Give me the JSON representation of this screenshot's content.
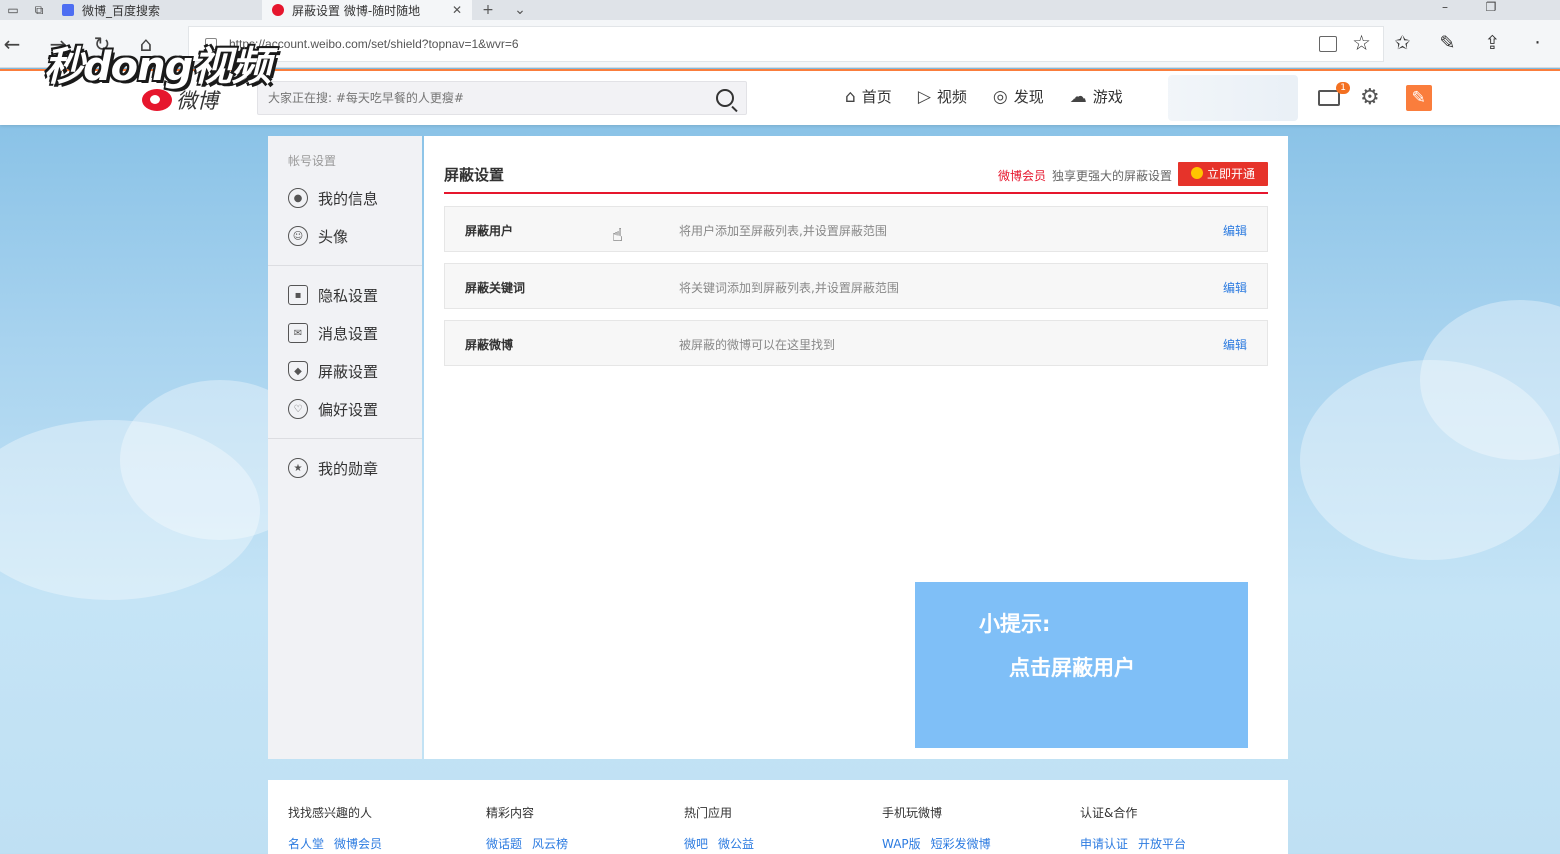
{
  "browser": {
    "tabs": [
      {
        "title": "微博_百度搜索",
        "active": false
      },
      {
        "title": "屏蔽设置 微博-随时随地",
        "active": true
      }
    ],
    "address": "https://account.weibo.com/set/shield?topnav=1&wvr=6",
    "icons": [
      "back-icon",
      "forward-icon",
      "refresh-icon",
      "home-icon",
      "lock-icon",
      "reading-view-icon",
      "favorite-star-icon",
      "favorites-hub-icon",
      "pen-icon",
      "share-icon",
      "more-icon"
    ]
  },
  "watermark": "秒dong视频",
  "header": {
    "logo_text": "微博",
    "search_placeholder": "大家正在搜: #每天吃早餐的人更瘦#",
    "nav": [
      {
        "label": "首页",
        "icon": "home-icon"
      },
      {
        "label": "视频",
        "icon": "video-icon"
      },
      {
        "label": "发现",
        "icon": "compass-icon"
      },
      {
        "label": "游戏",
        "icon": "gamepad-icon"
      }
    ],
    "mail_badge": "1",
    "accent": "#fa7d3c"
  },
  "sidebar": {
    "group_title": "帐号设置",
    "items": [
      {
        "label": "我的信息",
        "icon": "user-icon"
      },
      {
        "label": "头像",
        "icon": "avatar-icon"
      },
      {
        "label": "隐私设置",
        "icon": "lock-icon"
      },
      {
        "label": "消息设置",
        "icon": "message-icon"
      },
      {
        "label": "屏蔽设置",
        "icon": "shield-icon"
      },
      {
        "label": "偏好设置",
        "icon": "heart-icon"
      },
      {
        "label": "我的勋章",
        "icon": "medal-icon"
      }
    ]
  },
  "content": {
    "title": "屏蔽设置",
    "vip_link": "微博会员",
    "vip_note": "独享更强大的屏蔽设置",
    "vip_button": "立即开通",
    "rows": [
      {
        "name": "屏蔽用户",
        "desc": "将用户添加至屏蔽列表,并设置屏蔽范围",
        "action": "编辑"
      },
      {
        "name": "屏蔽关键词",
        "desc": "将关键词添加到屏蔽列表,并设置屏蔽范围",
        "action": "编辑"
      },
      {
        "name": "屏蔽微博",
        "desc": "被屏蔽的微博可以在这里找到",
        "action": "编辑"
      }
    ],
    "tip_title": "小提示:",
    "tip_body": "点击屏蔽用户",
    "tip_color": "#7fbff7",
    "red_accent": "#e6162d"
  },
  "footer": {
    "columns": [
      {
        "title": "找找感兴趣的人",
        "links": [
          "名人堂",
          "微博会员"
        ]
      },
      {
        "title": "精彩内容",
        "links": [
          "微话题",
          "风云榜"
        ]
      },
      {
        "title": "热门应用",
        "links": [
          "微吧",
          "微公益"
        ]
      },
      {
        "title": "手机玩微博",
        "links": [
          "WAP版",
          "短彩发微博"
        ]
      },
      {
        "title": "认证&合作",
        "links": [
          "申请认证",
          "开放平台"
        ]
      }
    ]
  }
}
